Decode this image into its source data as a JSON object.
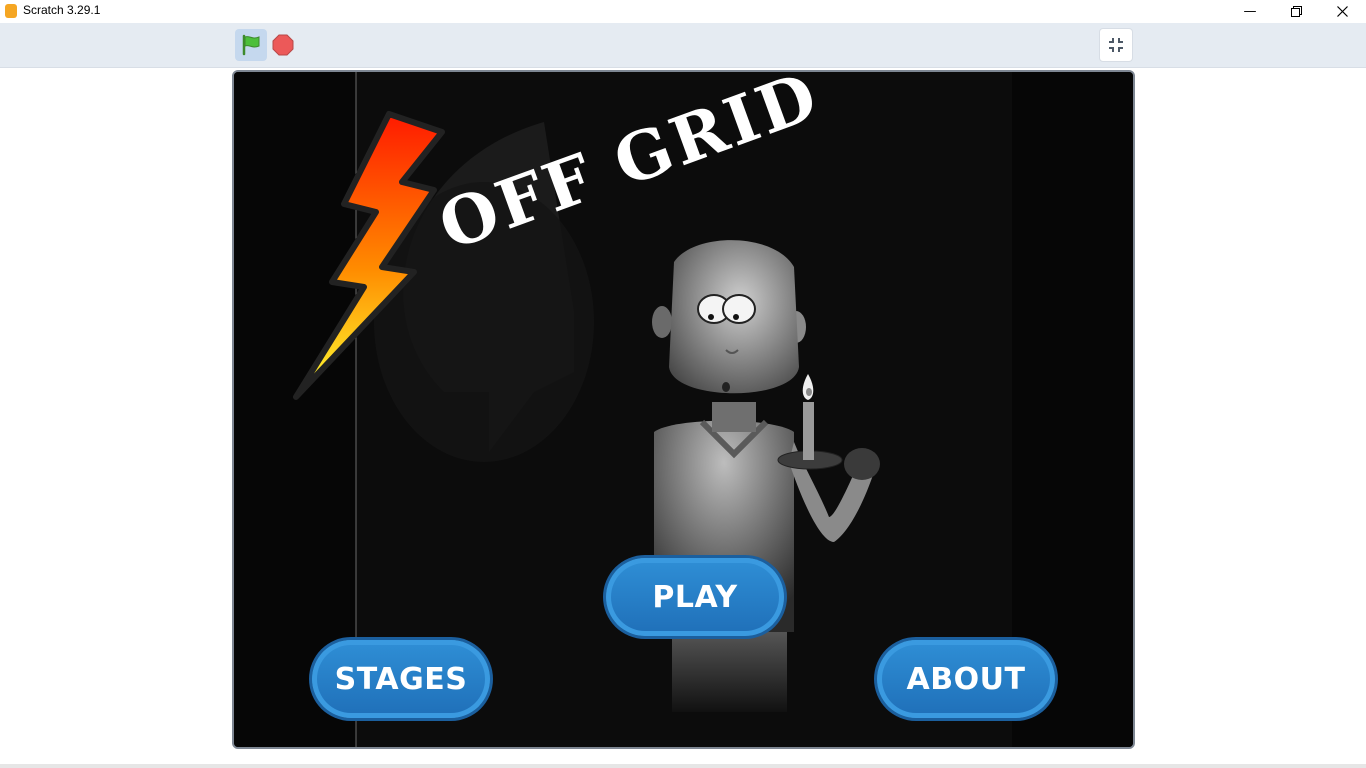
{
  "window": {
    "title": "Scratch 3.29.1",
    "minimize_icon": "minimize-icon",
    "restore_icon": "restore-icon",
    "close_icon": "close-icon"
  },
  "toolbar": {
    "green_flag_icon": "green-flag-icon",
    "stop_icon": "stop-icon",
    "unfullscreen_icon": "unfullscreen-icon"
  },
  "stage": {
    "title": "OFF GRID",
    "buttons": {
      "play": "PLAY",
      "stages": "STAGES",
      "about": "ABOUT"
    },
    "colors": {
      "button": "#2a82cc",
      "background": "#0c0c0c"
    }
  }
}
